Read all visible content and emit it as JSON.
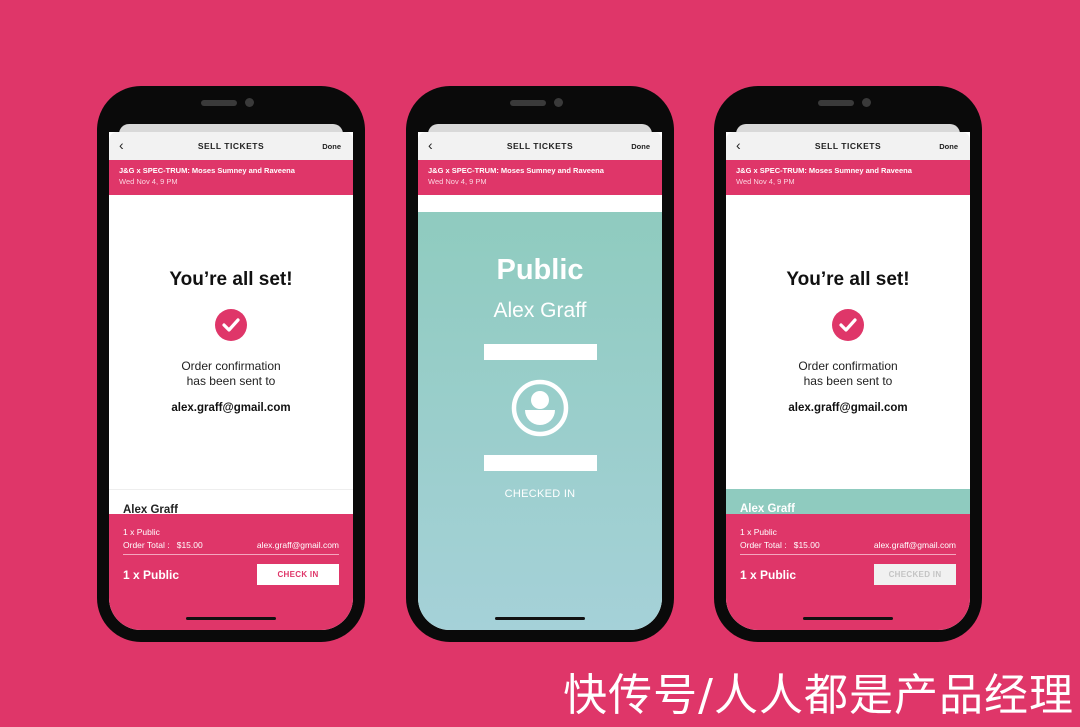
{
  "colors": {
    "brand": "#df3669",
    "checked": "#8fcbbf"
  },
  "phones": [
    {
      "nav": {
        "back_icon": "chevron-left-icon",
        "title": "SELL TICKETS",
        "done": "Done"
      },
      "event": {
        "name": "J&G x SPEC-TRUM: Moses Sumney and Raveena",
        "date": "Wed Nov 4, 9 PM"
      },
      "confirm": {
        "heading": "You’re all set!",
        "msg_line1": "Order confirmation",
        "msg_line2": "has been sent to",
        "email": "alex.graff@gmail.com"
      },
      "attendee": "Alex Graff",
      "order": {
        "qty": "1 x Public",
        "total_label": "Order Total :",
        "total": "$15.00",
        "email": "alex.graff@gmail.com",
        "ticket": "1 x Public",
        "button": "CHECK IN"
      }
    },
    {
      "nav": {
        "back_icon": "chevron-left-icon",
        "title": "SELL TICKETS",
        "done": "Done"
      },
      "event": {
        "name": "J&G x SPEC-TRUM: Moses Sumney and Raveena",
        "date": "Wed Nov 4, 9 PM"
      },
      "pass": {
        "type": "Public",
        "name": "Alex Graff",
        "status": "CHECKED IN"
      }
    },
    {
      "nav": {
        "back_icon": "chevron-left-icon",
        "title": "SELL TICKETS",
        "done": "Done"
      },
      "event": {
        "name": "J&G x SPEC-TRUM: Moses Sumney and Raveena",
        "date": "Wed Nov 4, 9 PM"
      },
      "confirm": {
        "heading": "You’re all set!",
        "msg_line1": "Order confirmation",
        "msg_line2": "has been sent to",
        "email": "alex.graff@gmail.com"
      },
      "attendee": "Alex Graff",
      "order": {
        "qty": "1 x Public",
        "total_label": "Order Total :",
        "total": "$15.00",
        "email": "alex.graff@gmail.com",
        "ticket": "1 x Public",
        "button": "CHECKED IN"
      }
    }
  ],
  "watermark": "快传号/人人都是产品经理"
}
